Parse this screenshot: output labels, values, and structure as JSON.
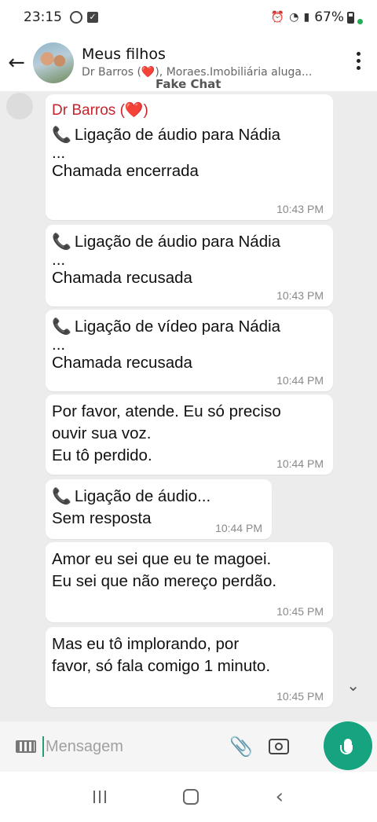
{
  "status_bar": {
    "time": "23:15",
    "battery": "67%"
  },
  "header": {
    "title": "Meus filhos",
    "subtitle": "Dr Barros (❤️),  Moraes.Imobiliária aluga..."
  },
  "watermark": "Fake Chat",
  "messages": [
    {
      "sender": "Dr Barros (❤️)",
      "lines": [
        "Ligação de áudio para Nádia"
      ],
      "ellipsis": "...",
      "extra": "Chamada encerrada",
      "time": "10:43 PM",
      "has_icon": true
    },
    {
      "lines": [
        "Ligação de áudio para Nádia"
      ],
      "ellipsis": "...",
      "extra": "Chamada recusada",
      "time": "10:43 PM",
      "has_icon": true
    },
    {
      "lines": [
        "Ligação de vídeo para Nádia"
      ],
      "ellipsis": "...",
      "extra": "Chamada recusada",
      "time": "10:44 PM",
      "has_icon": true
    },
    {
      "lines": [
        "Por favor, atende. Eu só preciso",
        "ouvir sua voz.",
        "Eu tô perdido."
      ],
      "time": "10:44 PM"
    },
    {
      "lines": [
        "Ligação de áudio..."
      ],
      "extra": "Sem resposta",
      "time": "10:44 PM",
      "has_icon": true
    },
    {
      "lines": [
        "Amor eu sei que eu te magoei.",
        "Eu sei que não mereço perdão."
      ],
      "time": "10:45 PM"
    },
    {
      "lines": [
        "Mas eu tô implorando, por",
        "favor, só fala comigo 1 minuto."
      ],
      "time": "10:45 PM"
    }
  ],
  "input": {
    "placeholder": "Mensagem"
  }
}
